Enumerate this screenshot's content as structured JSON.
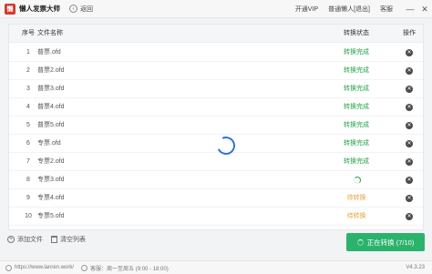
{
  "app": {
    "logo_text": "懒",
    "title": "懒人发票大师",
    "back_label": "返回"
  },
  "titlebar": {
    "vip_label": "开通VIP",
    "user_label": "普通懒人[退出]",
    "service_label": "客服"
  },
  "window": {
    "minimize": "—",
    "close": "✕"
  },
  "table": {
    "headers": {
      "index": "序号",
      "name": "文件名称",
      "status": "转换状态",
      "op": "操作"
    },
    "rows": [
      {
        "index": "1",
        "name": "普票.ofd",
        "status": "转换完成",
        "state": "done"
      },
      {
        "index": "2",
        "name": "普票2.ofd",
        "status": "转换完成",
        "state": "done"
      },
      {
        "index": "3",
        "name": "普票3.ofd",
        "status": "转换完成",
        "state": "done"
      },
      {
        "index": "4",
        "name": "普票4.ofd",
        "status": "转换完成",
        "state": "done"
      },
      {
        "index": "5",
        "name": "普票5.ofd",
        "status": "转换完成",
        "state": "done"
      },
      {
        "index": "6",
        "name": "专票.ofd",
        "status": "转换完成",
        "state": "done"
      },
      {
        "index": "7",
        "name": "专票2.ofd",
        "status": "转换完成",
        "state": "done"
      },
      {
        "index": "8",
        "name": "专票3.ofd",
        "status": "",
        "state": "converting"
      },
      {
        "index": "9",
        "name": "专票4.ofd",
        "status": "待转换",
        "state": "waiting"
      },
      {
        "index": "10",
        "name": "专票5.ofd",
        "status": "待转换",
        "state": "waiting"
      }
    ],
    "delete_icon": "✕"
  },
  "actions": {
    "add_file": "添加文件",
    "clear_list": "清空列表"
  },
  "convert_button": {
    "label": "正在转换 (7/10)"
  },
  "statusbar": {
    "url": "https://www.lanren.work/",
    "hours": "客服：周一至周五 (9:00 - 18:00)",
    "version": "V4.3.23"
  },
  "colors": {
    "accent_green": "#2bb36b",
    "done": "#24a148",
    "waiting": "#e6a23c",
    "spinner": "#2f72d8"
  }
}
